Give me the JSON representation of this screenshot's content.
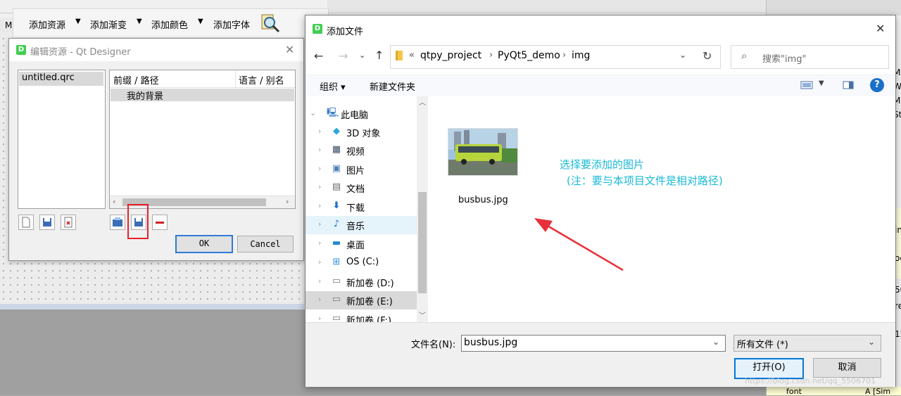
{
  "toolbar": {
    "items": [
      "添加资源",
      "添加渐变",
      "添加颜色",
      "添加字体"
    ],
    "arrow": "▼",
    "m_tag": "M"
  },
  "edit_dialog": {
    "title": "编辑资源 - Qt Designer",
    "icon_letter": "D",
    "resource_file": "untitled.qrc",
    "tree_headers": [
      "前缀 / 路径",
      "语言 / 别名"
    ],
    "tree_rows": [
      {
        "prefix": "我的背景",
        "alias": ""
      }
    ],
    "ok_label": "OK",
    "cancel_label": "Cancel"
  },
  "file_dialog": {
    "title": "添加文件",
    "icon_letter": "D",
    "breadcrumb": [
      "qtpy_project",
      "PyQt5_demo",
      "img"
    ],
    "breadcrumb_prefix": "«",
    "search_placeholder": "搜索\"img\"",
    "organize_label": "组织 ▾",
    "new_folder_label": "新建文件夹",
    "nav_items": [
      {
        "label": "此电脑",
        "icon": "computer-icon"
      },
      {
        "label": "3D 对象",
        "icon": "cube-icon"
      },
      {
        "label": "视频",
        "icon": "video-icon"
      },
      {
        "label": "图片",
        "icon": "picture-icon"
      },
      {
        "label": "文档",
        "icon": "document-icon"
      },
      {
        "label": "下载",
        "icon": "download-icon"
      },
      {
        "label": "音乐",
        "icon": "music-icon"
      },
      {
        "label": "桌面",
        "icon": "desktop-icon"
      },
      {
        "label": "OS (C:)",
        "icon": "windows-drive-icon"
      },
      {
        "label": "新加卷 (D:)",
        "icon": "drive-icon"
      },
      {
        "label": "新加卷 (E:)",
        "icon": "drive-icon"
      },
      {
        "label": "新加卷 (F:)",
        "icon": "drive-icon"
      }
    ],
    "files": [
      {
        "name": "busbus.jpg"
      }
    ],
    "annotation_line1": "选择要添加的图片",
    "annotation_line2": "(注：要与本项目文件是相对路径)",
    "filename_label": "文件名(N):",
    "filename_value": "busbus.jpg",
    "filetype_value": "所有文件 (*)",
    "open_label": "打开(O)",
    "cancel_label": "取消"
  },
  "right_panel": {
    "fragments": [
      "M",
      "W",
      "M",
      "St",
      "in",
      "oc",
      "50",
      "re",
      "12"
    ],
    "bottom_fragment": "font",
    "bottom_right": "A  [Sim"
  },
  "watermark": "https://blog.csdn.net/qq_5506701",
  "colors": {
    "accent": "#0078d7",
    "highlight_red": "#e8202a",
    "annotation": "#19b9d6",
    "arrow": "#e8303a"
  }
}
